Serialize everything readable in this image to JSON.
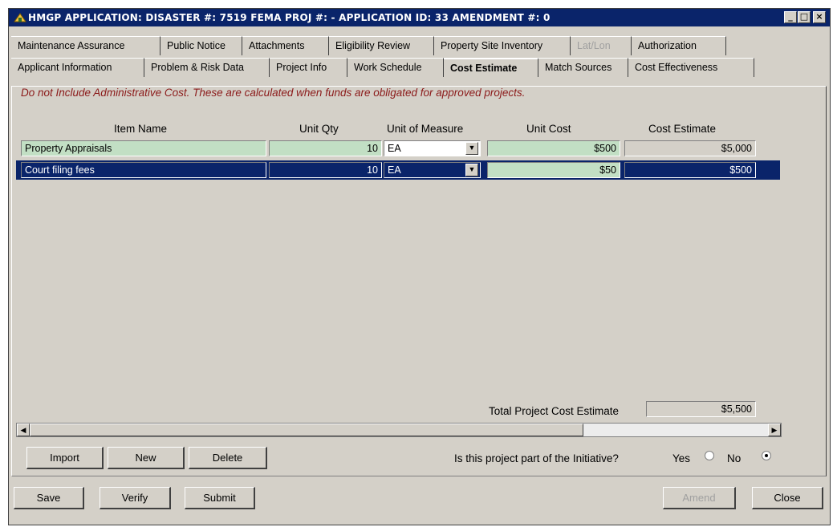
{
  "window": {
    "title": "HMGP APPLICATION:  DISASTER #: 7519   FEMA PROJ #:  -    APPLICATION ID: 33   AMENDMENT #: 0",
    "minimize": "_",
    "maximize": "□",
    "close": "×"
  },
  "tabs_row1": [
    {
      "label": "Maintenance Assurance"
    },
    {
      "label": "Public Notice"
    },
    {
      "label": "Attachments"
    },
    {
      "label": "Eligibility Review"
    },
    {
      "label": "Property Site Inventory"
    },
    {
      "label": "Lat/Lon",
      "disabled": true
    },
    {
      "label": "Authorization"
    }
  ],
  "tabs_row2": [
    {
      "label": "Applicant Information"
    },
    {
      "label": "Problem & Risk Data"
    },
    {
      "label": "Project Info"
    },
    {
      "label": "Work Schedule"
    },
    {
      "label": "Cost Estimate",
      "active": true
    },
    {
      "label": "Match Sources"
    },
    {
      "label": "Cost Effectiveness"
    }
  ],
  "notice": "Do not Include Administrative Cost.  These are calculated when funds are obligated for approved projects.",
  "table": {
    "headers": {
      "item_name": "Item Name",
      "unit_qty": "Unit Qty",
      "unit_of_measure": "Unit of Measure",
      "unit_cost": "Unit Cost",
      "cost_estimate": "Cost Estimate"
    },
    "rows": [
      {
        "item_name": "Property Appraisals",
        "unit_qty": "10",
        "unit_of_measure": "EA",
        "unit_cost": "$500",
        "cost_estimate": "$5,000"
      },
      {
        "item_name": "Court filing fees",
        "unit_qty": "10",
        "unit_of_measure": "EA",
        "unit_cost": "$50",
        "cost_estimate": "$500",
        "selected": true
      }
    ]
  },
  "total": {
    "label": "Total Project Cost Estimate",
    "value": "$5,500"
  },
  "initiative": {
    "question": "Is this project part of the Initiative?",
    "yes": "Yes",
    "no": "No",
    "selected": "No"
  },
  "buttons": {
    "import": "Import",
    "new": "New",
    "delete": "Delete",
    "save": "Save",
    "verify": "Verify",
    "submit": "Submit",
    "amend": "Amend",
    "close": "Close"
  },
  "scroll_arrows": {
    "left": "◀",
    "right": "▶"
  },
  "combo_arrow": "▼"
}
